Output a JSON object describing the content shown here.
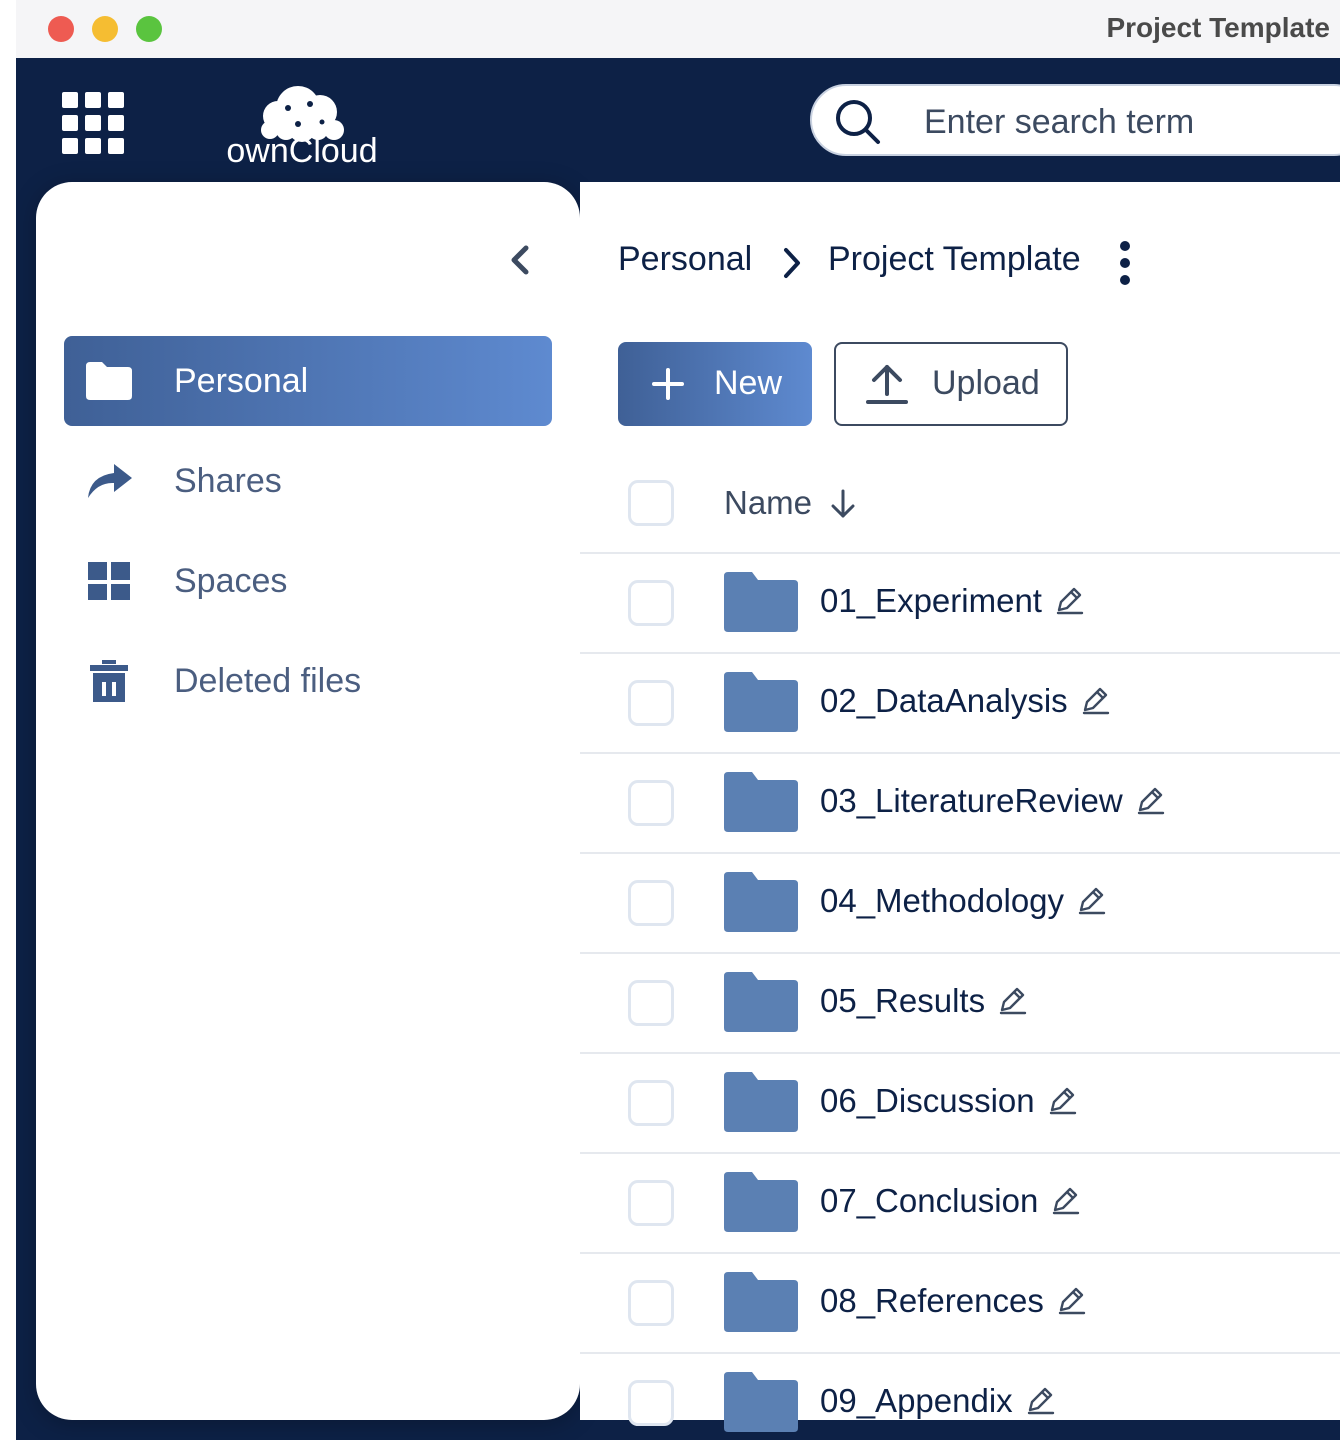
{
  "window": {
    "title": "Project Template"
  },
  "topbar": {
    "logo_text": "ownCloud",
    "search": {
      "placeholder": "Enter search term",
      "value": ""
    }
  },
  "sidebar": {
    "items": [
      {
        "label": "Personal",
        "icon": "folder-icon",
        "active": true
      },
      {
        "label": "Shares",
        "icon": "share-icon",
        "active": false
      },
      {
        "label": "Spaces",
        "icon": "spaces-grid-icon",
        "active": false
      },
      {
        "label": "Deleted files",
        "icon": "trash-icon",
        "active": false
      }
    ]
  },
  "breadcrumb": {
    "root": "Personal",
    "current": "Project Template"
  },
  "toolbar": {
    "new_label": "New",
    "upload_label": "Upload"
  },
  "table": {
    "name_header": "Name",
    "rows": [
      {
        "name": "01_Experiment"
      },
      {
        "name": "02_DataAnalysis"
      },
      {
        "name": "03_LiteratureReview"
      },
      {
        "name": "04_Methodology"
      },
      {
        "name": "05_Results"
      },
      {
        "name": "06_Discussion"
      },
      {
        "name": "07_Conclusion"
      },
      {
        "name": "08_References"
      },
      {
        "name": "09_Appendix"
      }
    ]
  },
  "colors": {
    "brand_dark": "#0d2146",
    "accent": "#4f78b9",
    "folder": "#5b80b3"
  }
}
